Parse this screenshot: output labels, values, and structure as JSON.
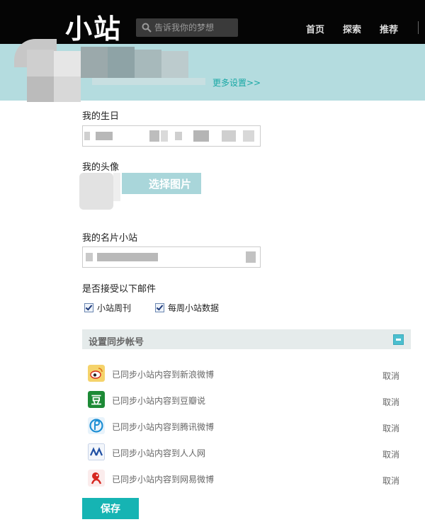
{
  "header": {
    "logo": "小站",
    "search_placeholder": "告诉我你的梦想",
    "nav": {
      "home": "首页",
      "explore": "探索",
      "recommend": "推荐"
    }
  },
  "banner": {
    "more_settings": "更多设置>>"
  },
  "form": {
    "birthday_label": "我的生日",
    "avatar_label": "我的头像",
    "choose_image": "选择图片",
    "card_label": "我的名片小站",
    "mail_label": "是否接受以下邮件",
    "options": [
      {
        "label": "小站周刊",
        "checked": true
      },
      {
        "label": "每周小站数据",
        "checked": true
      }
    ]
  },
  "sync": {
    "title": "设置同步帐号",
    "rows": [
      {
        "text": "已同步小站内容到新浪微博",
        "cancel": "取消",
        "icon": "sina-weibo-icon"
      },
      {
        "text": "已同步小站内容到豆瓣说",
        "cancel": "取消",
        "icon": "douban-icon"
      },
      {
        "text": "已同步小站内容到腾讯微博",
        "cancel": "取消",
        "icon": "tencent-weibo-icon"
      },
      {
        "text": "已同步小站内容到人人网",
        "cancel": "取消",
        "icon": "renren-icon"
      },
      {
        "text": "已同步小站内容到网易微博",
        "cancel": "取消",
        "icon": "netease-weibo-icon"
      }
    ]
  },
  "save_label": "保存",
  "colors": {
    "accent": "#16b4b3",
    "banner": "#b4dcdf",
    "topbar": "#050505"
  }
}
